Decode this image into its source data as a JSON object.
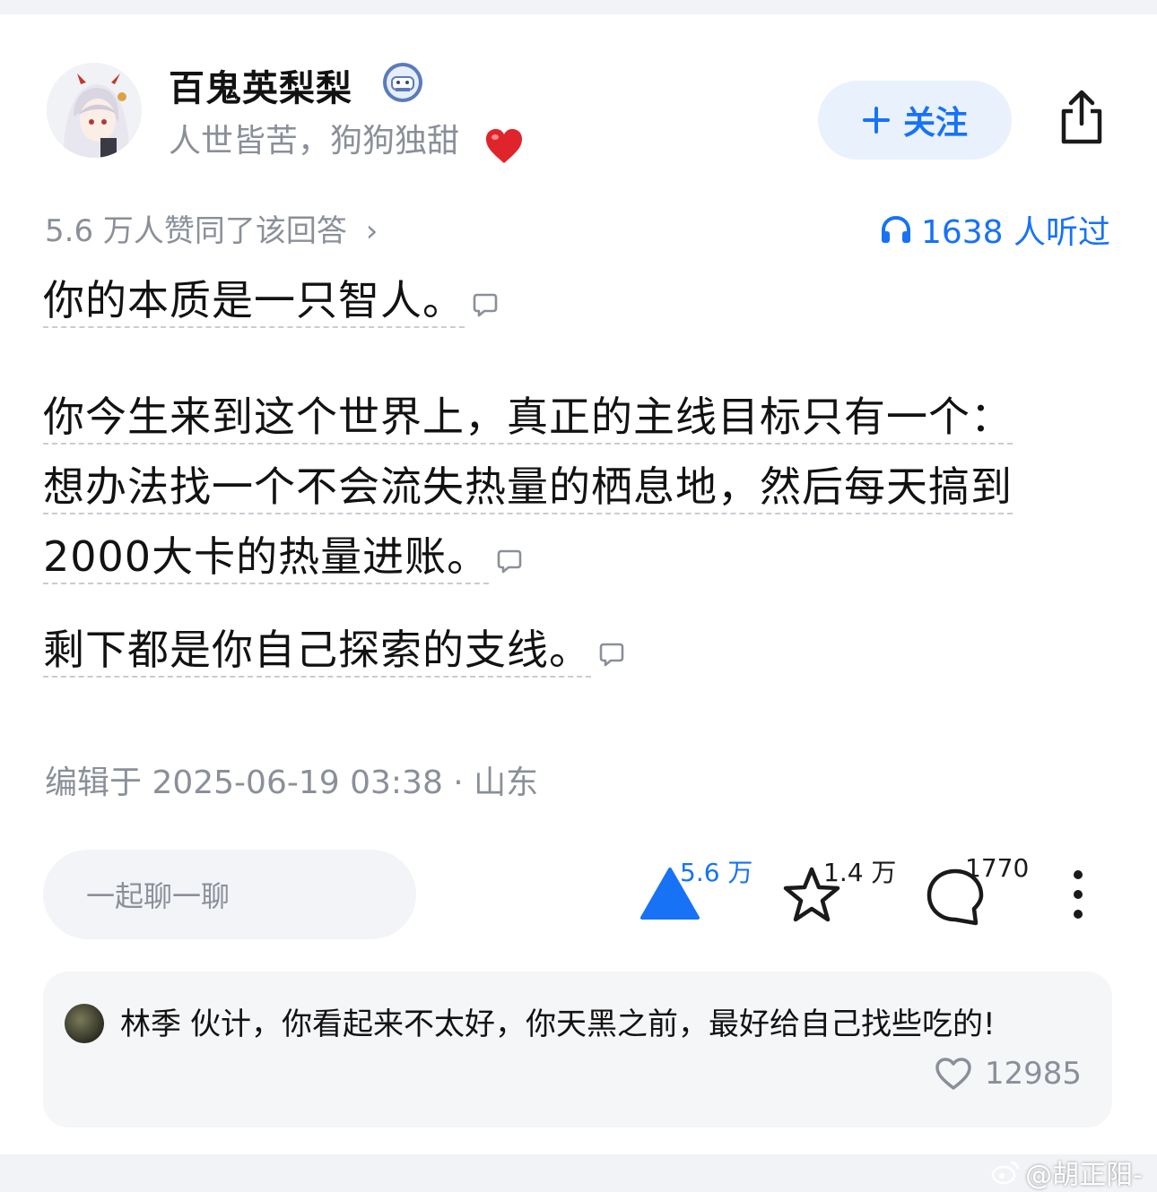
{
  "author": {
    "name": "百鬼英梨梨",
    "bio": "人世皆苦，狗狗独甜"
  },
  "header": {
    "follow_label": "关注"
  },
  "stats": {
    "agree_text": "5.6 万人赞同了该回答",
    "listen_text": "1638 人听过"
  },
  "content": {
    "p1": "你的本质是一只智人。",
    "p2_line1": "你今生来到这个世界上，真正的主线目标只有一个：",
    "p2_line2": "想办法找一个不会流失热量的栖息地，然后每天搞到",
    "p2_line3": "2000大卡的热量进账。",
    "p3": "剩下都是你自己探索的支线。"
  },
  "meta": {
    "edited": "编辑于 2025-06-19 03:38 · 山东"
  },
  "actions": {
    "chat_placeholder": "一起聊一聊",
    "upvote_count": "5.6 万",
    "favorite_count": "1.4 万",
    "comment_count": "1770"
  },
  "hot_comment": {
    "author": "林季",
    "text": "伙计，你看起来不太好，你天黑之前，最好给自己找些吃的!",
    "likes": "12985"
  },
  "watermark": {
    "text": "@胡正阳-"
  },
  "colors": {
    "accent": "#1772f6",
    "muted": "#8a8f99",
    "heart": "#e0242b"
  }
}
